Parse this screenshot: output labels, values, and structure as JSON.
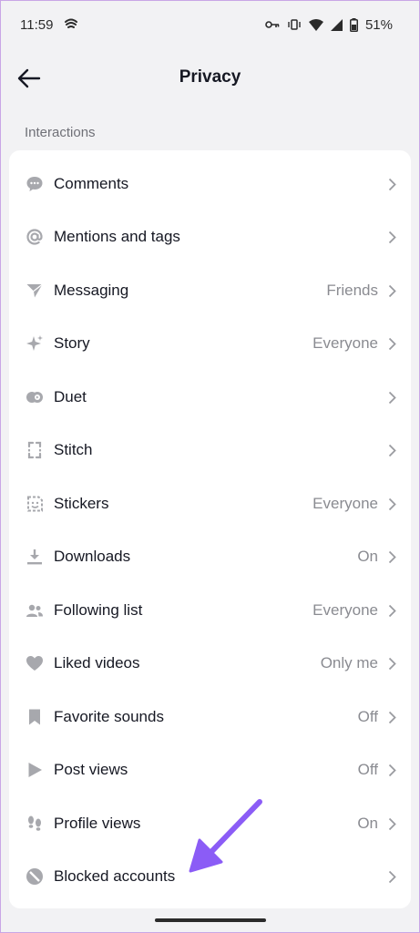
{
  "status_bar": {
    "time": "11:59",
    "battery_percent": "51%"
  },
  "header": {
    "title": "Privacy"
  },
  "section": {
    "label": "Interactions"
  },
  "rows": [
    {
      "label": "Comments",
      "value": "",
      "icon": "comment-icon"
    },
    {
      "label": "Mentions and tags",
      "value": "",
      "icon": "at-icon"
    },
    {
      "label": "Messaging",
      "value": "Friends",
      "icon": "send-icon"
    },
    {
      "label": "Story",
      "value": "Everyone",
      "icon": "sparkle-icon"
    },
    {
      "label": "Duet",
      "value": "",
      "icon": "duet-icon"
    },
    {
      "label": "Stitch",
      "value": "",
      "icon": "stitch-icon"
    },
    {
      "label": "Stickers",
      "value": "Everyone",
      "icon": "sticker-icon"
    },
    {
      "label": "Downloads",
      "value": "On",
      "icon": "download-icon"
    },
    {
      "label": "Following list",
      "value": "Everyone",
      "icon": "people-icon"
    },
    {
      "label": "Liked videos",
      "value": "Only me",
      "icon": "heart-icon"
    },
    {
      "label": "Favorite sounds",
      "value": "Off",
      "icon": "bookmark-icon"
    },
    {
      "label": "Post views",
      "value": "Off",
      "icon": "play-icon"
    },
    {
      "label": "Profile views",
      "value": "On",
      "icon": "footprints-icon"
    },
    {
      "label": "Blocked accounts",
      "value": "",
      "icon": "block-icon"
    }
  ],
  "colors": {
    "background": "#f2f2f4",
    "card": "#ffffff",
    "icon": "#a7a8ad",
    "annotation": "#8b5cf6"
  }
}
